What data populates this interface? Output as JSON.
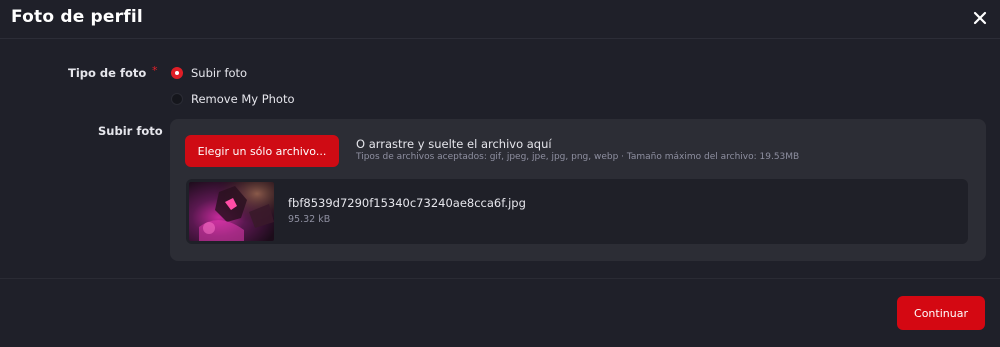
{
  "dialog": {
    "title": "Foto de perfil"
  },
  "form": {
    "photo_type": {
      "label": "Tipo de foto",
      "required_marker": "*",
      "options": [
        {
          "label": "Subir foto",
          "selected": true
        },
        {
          "label": "Remove My Photo",
          "selected": false
        }
      ]
    },
    "upload": {
      "label": "Subir foto",
      "choose_button": "Elegir un sólo archivo...",
      "drop_text": "O arrastre y suelte el archivo aquí",
      "hint": "Tipos de archivos aceptados: gif, jpeg, jpe, jpg, png, webp · Tamaño máximo del archivo: 19.53MB",
      "file": {
        "name": "fbf8539d7290f15340c73240ae8cca6f.jpg",
        "size": "95.32 kB",
        "thumbnail_icon": "image-thumbnail"
      }
    }
  },
  "footer": {
    "continue_label": "Continuar"
  },
  "colors": {
    "accent": "#d40812",
    "background": "#1f2029",
    "panel": "#2c2d35"
  }
}
